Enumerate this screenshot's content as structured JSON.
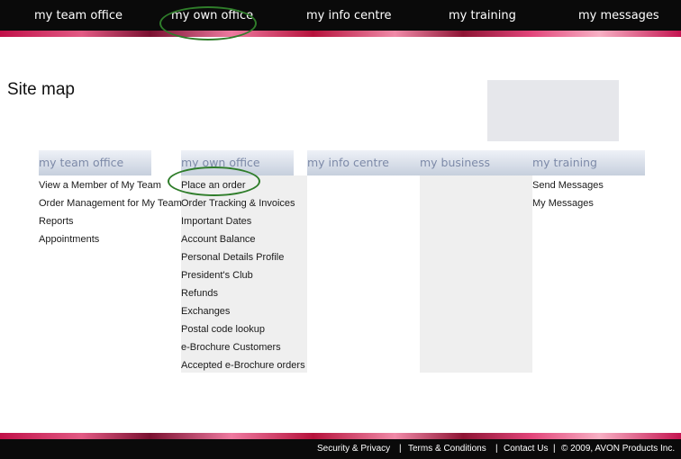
{
  "nav": {
    "items": [
      "my team office",
      "my own office",
      "my info centre",
      "my training",
      "my messages"
    ]
  },
  "page": {
    "title": "Site map"
  },
  "sitemap": {
    "columns": [
      {
        "heading": "my team office",
        "links": [
          "View a Member of My Team",
          "Order Management for My Team",
          "Reports",
          "Appointments"
        ]
      },
      {
        "heading": "my own office",
        "links": [
          "Place an order",
          "Order Tracking & Invoices",
          "Important Dates",
          "Account Balance",
          "Personal Details Profile",
          "President's Club",
          "Refunds",
          "Exchanges",
          "Postal code lookup",
          "e-Brochure Customers",
          "Accepted e-Brochure orders"
        ]
      },
      {
        "heading": "my info centre",
        "links": []
      },
      {
        "heading": "my business",
        "links": []
      },
      {
        "heading": "my training",
        "links": [
          "Send Messages",
          "My Messages"
        ]
      }
    ]
  },
  "footer": {
    "links": [
      "Security & Privacy",
      "Terms & Conditions",
      "Contact Us"
    ],
    "separator": "|",
    "copyright": "© 2009, AVON Products Inc."
  },
  "colors": {
    "annotation": "#2f7d2a",
    "header_text": "#7d8aa8"
  }
}
